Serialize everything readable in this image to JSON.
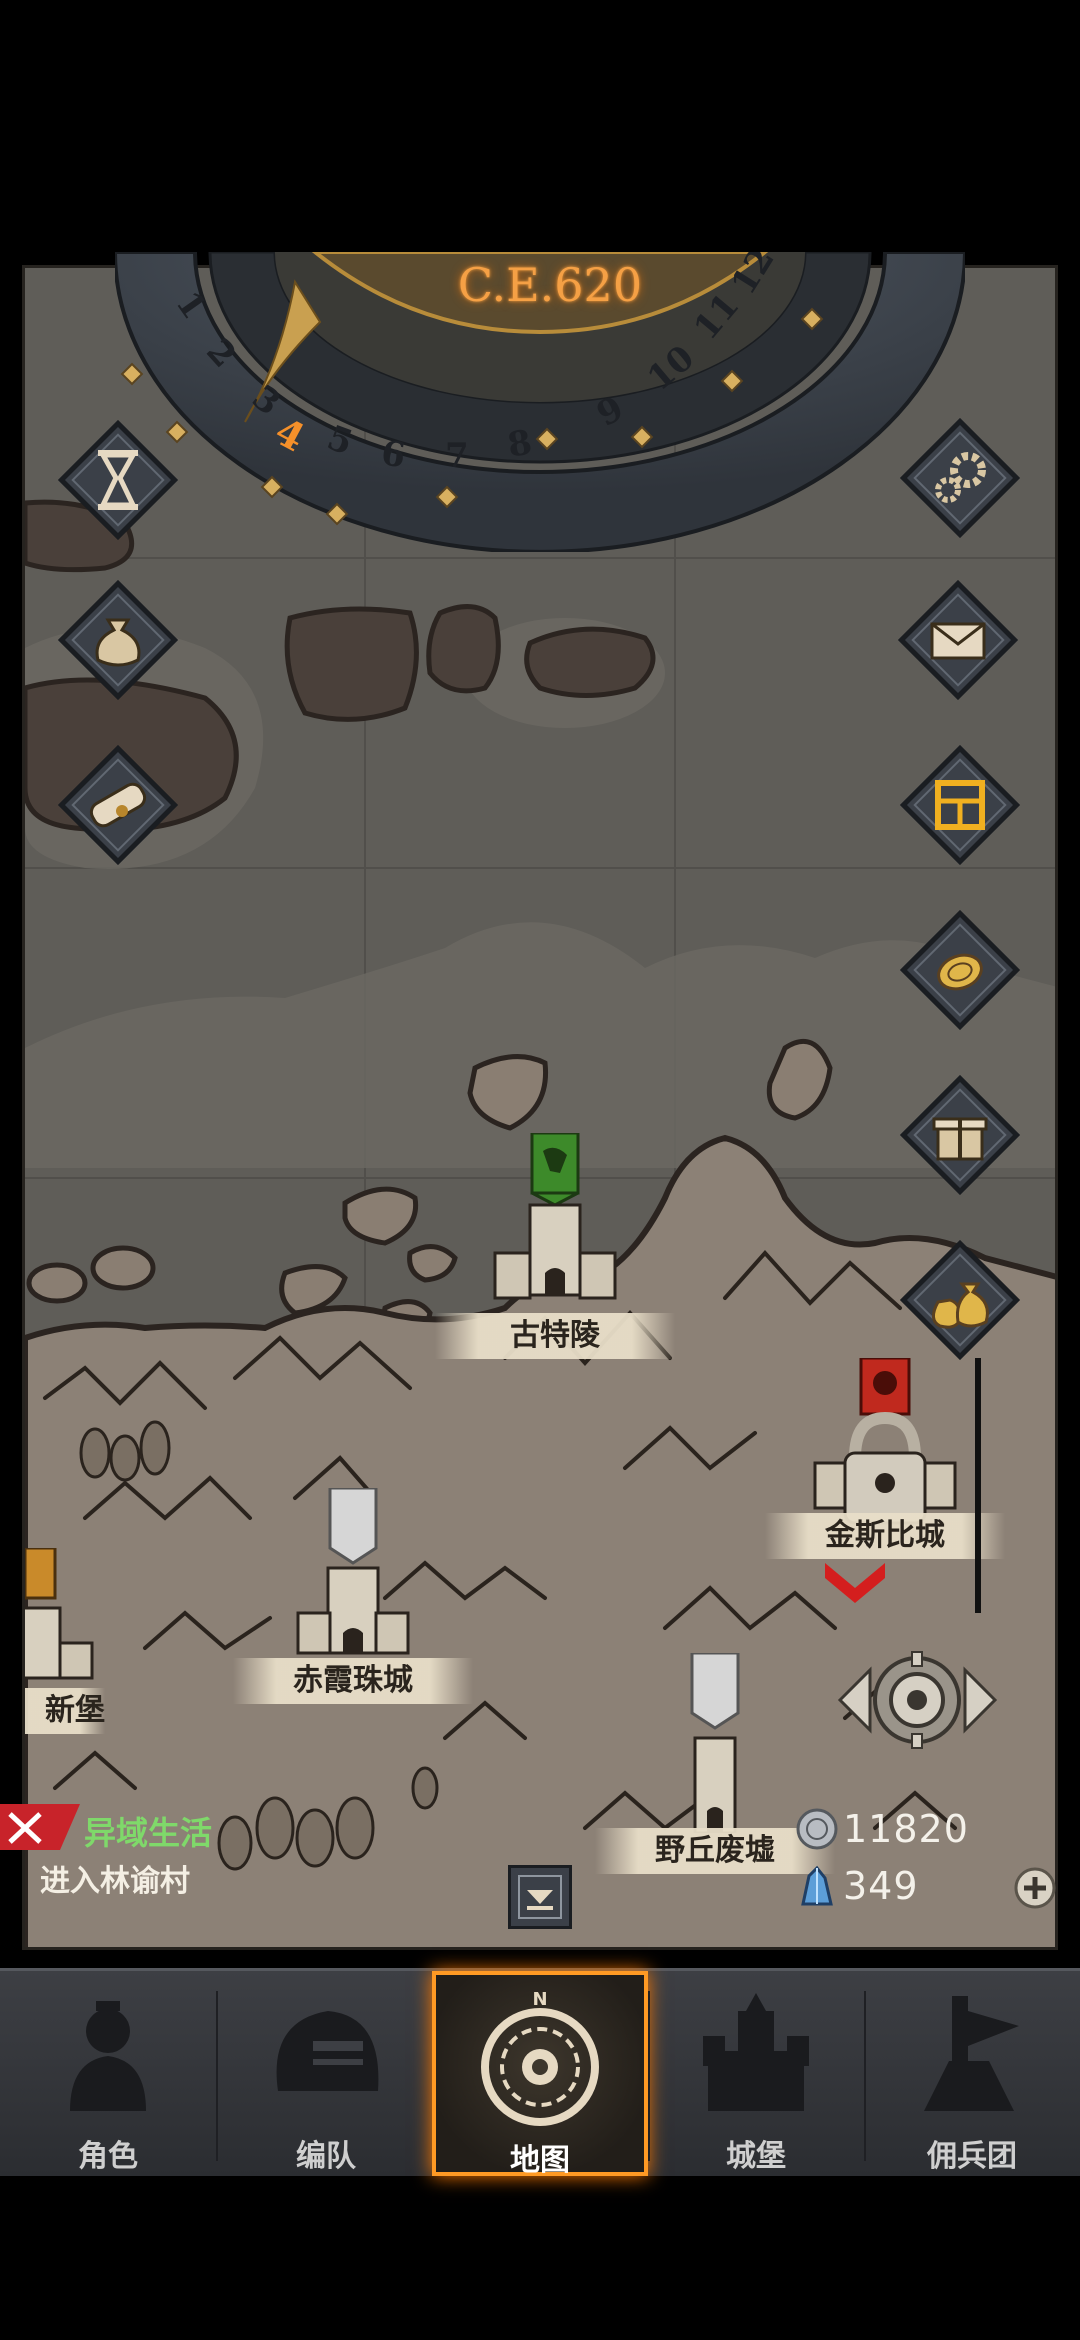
{
  "calendar": {
    "year_label": "C.E.620",
    "months": [
      "1",
      "2",
      "3",
      "4",
      "5",
      "6",
      "7",
      "8",
      "9",
      "10",
      "11",
      "12"
    ],
    "current_month": "4"
  },
  "left_buttons": [
    {
      "icon": "hourglass-icon"
    },
    {
      "icon": "money-bag-icon"
    },
    {
      "icon": "scroll-icon"
    }
  ],
  "right_buttons": [
    {
      "icon": "gear-icon"
    },
    {
      "icon": "envelope-icon"
    },
    {
      "icon": "calendar-board-icon"
    },
    {
      "icon": "coin-icon"
    },
    {
      "icon": "gift-icon"
    },
    {
      "icon": "money-bags-icon"
    }
  ],
  "towns": [
    {
      "name": "古特陵",
      "banner": "green"
    },
    {
      "name": "赤霞珠城",
      "banner": "white"
    },
    {
      "name": "野丘废墟",
      "banner": "white"
    },
    {
      "name": "金斯比城",
      "banner": "red",
      "locked": true
    },
    {
      "name": "新堡",
      "banner": "orange"
    }
  ],
  "quest": {
    "title": "异域生活",
    "description": "进入林谕村"
  },
  "resources": {
    "silver": "11820",
    "crystal": "349"
  },
  "tabs": [
    {
      "label": "角色",
      "icon": "knight-icon"
    },
    {
      "label": "编队",
      "icon": "helmet-icon"
    },
    {
      "label": "地图",
      "icon": "compass-icon",
      "active": true,
      "compass_letter": "N"
    },
    {
      "label": "城堡",
      "icon": "castle-icon"
    },
    {
      "label": "佣兵团",
      "icon": "mercenary-icon"
    }
  ],
  "colors": {
    "accent_orange": "#ff9a24",
    "quest_green": "#7fd96a",
    "map_sea": "#5f5d58",
    "map_land": "#8a7e72"
  }
}
